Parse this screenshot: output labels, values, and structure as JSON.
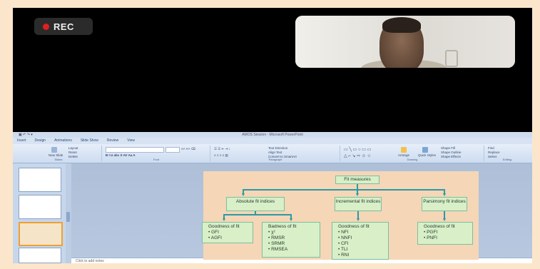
{
  "recording": {
    "label": "REC"
  },
  "ppt": {
    "title": "AMOS Session - Microsoft PowerPoint",
    "tabs": [
      "Insert",
      "Design",
      "Animations",
      "Slide Show",
      "Review",
      "View"
    ],
    "ribbon": {
      "slides_group": {
        "new_slide": "New Slide",
        "layout": "Layout",
        "reset": "Reset",
        "delete": "Delete",
        "label": "Slides"
      },
      "font_group_label": "Font",
      "paragraph_group": {
        "text_direction": "Text Direction",
        "align_text": "Align Text",
        "convert": "Convert to SmartArt",
        "label": "Paragraph"
      },
      "drawing_group": {
        "arrange": "Arrange",
        "quick_styles": "Quick Styles",
        "shape_fill": "Shape Fill",
        "shape_outline": "Shape Outline",
        "shape_effects": "Shape Effects",
        "label": "Drawing"
      },
      "editing_group": {
        "find": "Find",
        "replace": "Replace",
        "select": "Select",
        "label": "Editing"
      }
    },
    "notes_placeholder": "Click to add notes"
  },
  "slide": {
    "root": "Fit measures",
    "categories": [
      {
        "title": "Absolute fit indices",
        "children": [
          {
            "title": "Goodness of fit",
            "items": [
              "GFI",
              "AGFI"
            ]
          },
          {
            "title": "Badness of fit",
            "items": [
              "χ²",
              "RMSR",
              "SRMR",
              "RMSEA"
            ]
          }
        ]
      },
      {
        "title": "Incremental fit indices",
        "children": [
          {
            "title": "Goodness of fit",
            "items": [
              "NFI",
              "NNFI",
              "CFI",
              "TLI",
              "RNI"
            ]
          }
        ]
      },
      {
        "title": "Parsimony fit indices",
        "children": [
          {
            "title": "Goodness of fit",
            "items": [
              "PGFI",
              "PNFI"
            ]
          }
        ]
      }
    ]
  },
  "colors": {
    "connector": "#2a9aa6",
    "box_fill": "#d8efc8",
    "slide_bg": "#f5d6b6",
    "rec_dot": "#e02020"
  }
}
